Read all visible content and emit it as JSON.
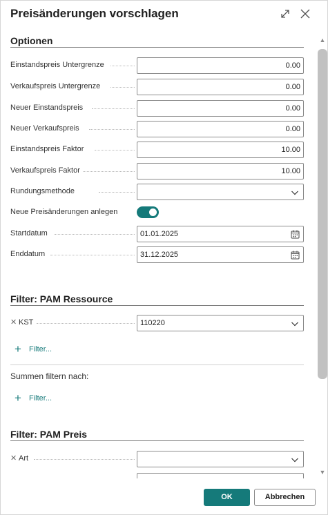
{
  "dialog": {
    "title": "Preisänderungen vorschlagen",
    "icons": {
      "expand": "expand-icon",
      "close": "close-icon"
    }
  },
  "options": {
    "title": "Optionen",
    "fields": [
      {
        "label": "Einstandspreis Untergrenze",
        "value": "0.00"
      },
      {
        "label": "Verkaufspreis Untergrenze",
        "value": "0.00"
      },
      {
        "label": "Neuer Einstandspreis",
        "value": "0.00"
      },
      {
        "label": "Neuer Verkaufspreis",
        "value": "0.00"
      },
      {
        "label": "Einstandspreis Faktor",
        "value": "10.00"
      },
      {
        "label": "Verkaufspreis Faktor",
        "value": "10.00"
      }
    ],
    "rounding": {
      "label": "Rundungsmethode",
      "value": ""
    },
    "new_changes": {
      "label": "Neue Preisänderungen anlegen",
      "checked": true
    },
    "start_date": {
      "label": "Startdatum",
      "value": "01.01.2025"
    },
    "end_date": {
      "label": "Enddatum",
      "value": "31.12.2025"
    }
  },
  "filter_resource": {
    "title": "Filter: PAM Ressource",
    "filter_field": {
      "label": "KST",
      "value": "110220"
    },
    "add_filter": "Filter...",
    "sum_label": "Summen filtern nach:",
    "sum_add_filter": "Filter..."
  },
  "filter_price": {
    "title": "Filter: PAM Preis",
    "filter_field": {
      "label": "Art",
      "value": ""
    }
  },
  "footer": {
    "ok_label": "OK",
    "cancel_label": "Abbrechen"
  },
  "colors": {
    "accent": "#157a7a",
    "border": "#8a8a8a"
  }
}
